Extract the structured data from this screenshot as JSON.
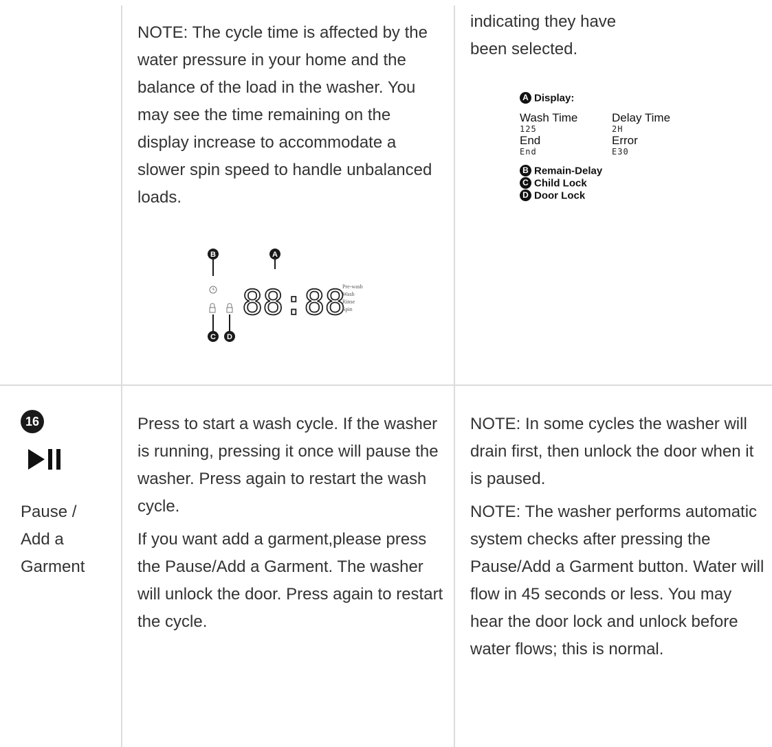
{
  "row1": {
    "note": "NOTE: The cycle time is affected by the water pressure in your home and the balance of the load in the washer. You may see the time remaining on the display increase to accommodate a slower spin speed to handle unbalanced loads.",
    "right_text": "indicating they have been selected.",
    "display_diagram": {
      "digits": "88:88",
      "labels": [
        "Pre-wash",
        "Wash",
        "Rinse",
        "Spin"
      ],
      "markers": [
        "A",
        "B",
        "C",
        "D"
      ]
    },
    "legend": {
      "display_label": "Display:",
      "wash_time_label": "Wash Time",
      "wash_time_value": "125",
      "delay_time_label": "Delay Time",
      "delay_time_value": "2H",
      "end_label": "End",
      "end_value": "End",
      "error_label": "Error",
      "error_value": "E30",
      "remain_delay": "Remain-Delay",
      "child_lock": "Child Lock",
      "door_lock": "Door Lock"
    }
  },
  "row2": {
    "number": "16",
    "icon": "play-pause-icon",
    "name_line1": "Pause /",
    "name_line2": "Add a",
    "name_line3": "Garment",
    "desc1": "Press to start a wash cycle. If the washer is running, pressing it once will pause the washer. Press again to restart the wash cycle.",
    "desc2": "If you want add a garment,please press the Pause/Add a Garment. The washer will unlock the door. Press again to restart the cycle.",
    "note1": "NOTE: In some cycles the washer will drain first, then unlock the door when it is paused.",
    "note2": "NOTE: The washer performs automatic system checks after pressing the Pause/Add a Garment button. Water will flow in 45 seconds or less. You may hear the door lock and unlock before water flows; this is normal."
  }
}
